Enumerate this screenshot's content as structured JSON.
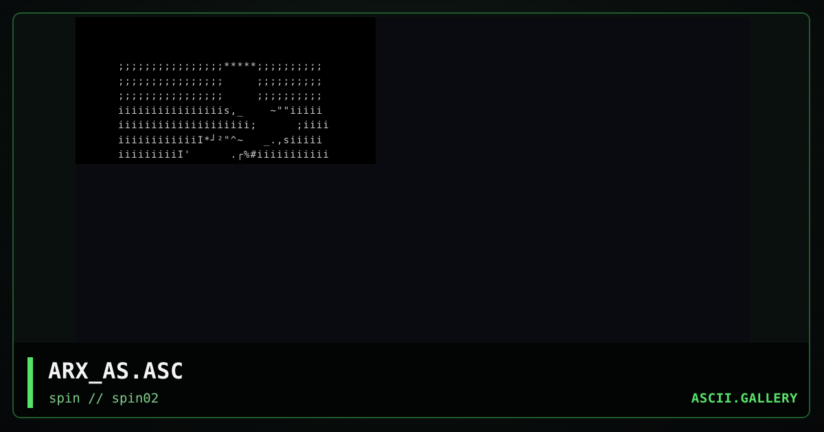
{
  "artwork": {
    "lines": [
      ";;;;;;;;;;;;;;;;*****;;;;;;;;;;",
      ";;;;;;;;;;;;;;;;     ;;;;;;;;;;",
      ";;;;;;;;;;;;;;;;     ;;;;;;;;;;",
      "iiiiiiiiiiiiiiiis,_    ~\"\"iiiii",
      "iiiiiiiiiiiiiiiiiiii;      ;iiii",
      "iiiiiiiiiiiiI*┘²\"^~   _.,siiiii",
      "iiiiiiiiiI'      .┌%#iiiiiiiiiii"
    ]
  },
  "footer": {
    "title": "ARX_AS.ASC",
    "subtitle": "spin // spin02",
    "brand": "ASCII.GALLERY"
  },
  "colors": {
    "accent": "#57e36a",
    "frame_border": "#1f5a2c",
    "art_text": "#c8c8c8",
    "title_text": "#f4f4f4",
    "subtitle_text": "#7fcf8a"
  }
}
